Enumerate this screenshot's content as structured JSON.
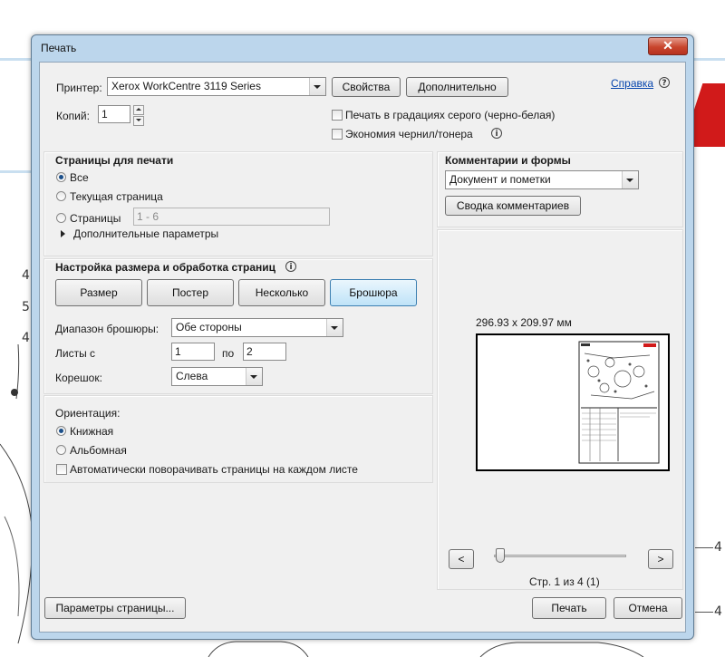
{
  "window": {
    "title": "Печать",
    "close_glyph": "✕"
  },
  "printer": {
    "label": "Принтер:",
    "selected": "Xerox WorkCentre 3119 Series",
    "properties_button": "Свойства",
    "advanced_button": "Дополнительно",
    "help_link": "Справка",
    "help_icon": "?"
  },
  "copies": {
    "label": "Копий:",
    "value": "1"
  },
  "options": {
    "grayscale": "Печать в градациях серого (черно-белая)",
    "save_ink": "Экономия чернил/тонера",
    "info_icon": "i"
  },
  "pages": {
    "title": "Страницы для печати",
    "all": "Все",
    "current": "Текущая страница",
    "range": "Страницы",
    "range_value": "1 - 6",
    "more": "Дополнительные параметры"
  },
  "sizing": {
    "title": "Настройка размера и обработка страниц",
    "info_icon": "i",
    "buttons": [
      "Размер",
      "Постер",
      "Несколько",
      "Брошюра"
    ],
    "active": "Брошюра",
    "booklet_range_label": "Диапазон брошюры:",
    "booklet_range_value": "Обе стороны",
    "sheets_label": "Листы с",
    "sheets_from": "1",
    "sheets_to_label": "по",
    "sheets_to": "2",
    "binding_label": "Корешок:",
    "binding_value": "Слева"
  },
  "orientation": {
    "title": "Ориентация:",
    "portrait": "Книжная",
    "landscape": "Альбомная",
    "auto_rotate": "Автоматически поворачивать страницы на каждом листе"
  },
  "comments": {
    "title": "Комментарии и формы",
    "selected": "Документ и пометки",
    "summary_button": "Сводка комментариев"
  },
  "preview": {
    "size_text": "296.93 x 209.97 мм",
    "page_status": "Стр. 1 из 4 (1)",
    "prev": "<",
    "next": ">",
    "slider_position": 0
  },
  "footer": {
    "page_setup": "Параметры страницы...",
    "print": "Печать",
    "cancel": "Отмена"
  },
  "background": {
    "numbers": [
      "4",
      "5",
      "4",
      "4",
      "4"
    ]
  }
}
